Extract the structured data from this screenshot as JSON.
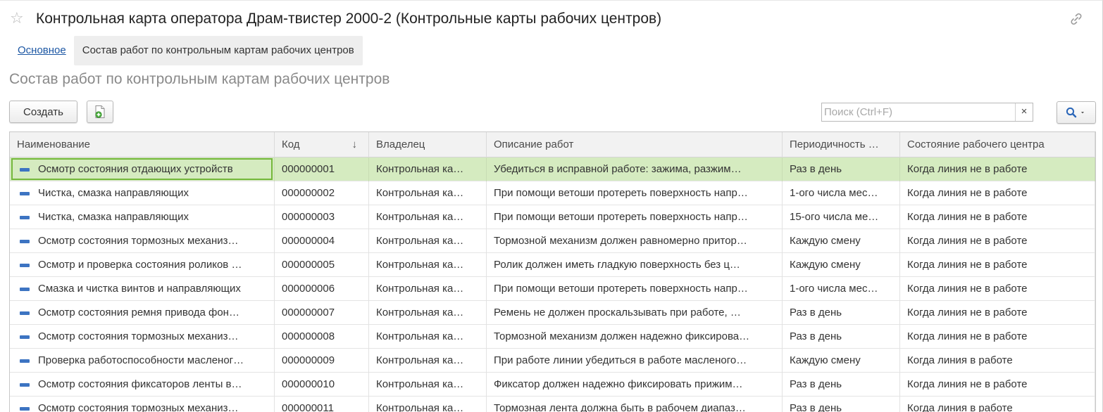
{
  "window": {
    "title": "Контрольная карта оператора Драм-твистер 2000-2 (Контрольные карты рабочих центров)"
  },
  "tabs": {
    "main_link": "Основное",
    "active": "Состав работ по контрольным картам рабочих центров"
  },
  "section": {
    "title": "Состав работ по контрольным картам рабочих центров"
  },
  "toolbar": {
    "create_label": "Создать",
    "search_placeholder": "Поиск (Ctrl+F)",
    "search_clear": "×"
  },
  "table": {
    "columns": [
      "Наименование",
      "Код",
      "Владелец",
      "Описание работ",
      "Периодичность …",
      "Состояние рабочего центра"
    ],
    "sort_indicator": "↓",
    "rows": [
      {
        "name": "Осмотр состояния отдающих устройств",
        "code": "000000001",
        "owner": "Контрольная ка…",
        "description": "Убедиться в исправной работе: зажима, разжим…",
        "period": "Раз в день",
        "state": "Когда линия не в работе"
      },
      {
        "name": "Чистка, смазка направляющих",
        "code": "000000002",
        "owner": "Контрольная ка…",
        "description": "При помощи ветоши протереть поверхность напр…",
        "period": "1-ого числа мес…",
        "state": "Когда линия не в работе"
      },
      {
        "name": "Чистка, смазка направляющих",
        "code": "000000003",
        "owner": "Контрольная ка…",
        "description": "При помощи ветоши протереть поверхность напр…",
        "period": "15-ого числа ме…",
        "state": "Когда линия не в работе"
      },
      {
        "name": "Осмотр состояния тормозных механиз…",
        "code": "000000004",
        "owner": "Контрольная ка…",
        "description": "Тормозной механизм должен равномерно притор…",
        "period": "Каждую смену",
        "state": "Когда линия не в работе"
      },
      {
        "name": "Осмотр и проверка состояния роликов …",
        "code": "000000005",
        "owner": "Контрольная ка…",
        "description": "Ролик должен иметь гладкую поверхность без ц…",
        "period": "Каждую смену",
        "state": "Когда линия не в работе"
      },
      {
        "name": "Смазка и чистка винтов и направляющих",
        "code": "000000006",
        "owner": "Контрольная ка…",
        "description": "При помощи ветоши протереть поверхность напр…",
        "period": "1-ого числа мес…",
        "state": "Когда линия не в работе"
      },
      {
        "name": "Осмотр состояния ремня привода фон…",
        "code": "000000007",
        "owner": "Контрольная ка…",
        "description": "Ремень не должен проскальзывать при работе, …",
        "period": "Раз в день",
        "state": "Когда линия не в работе"
      },
      {
        "name": "Осмотр состояния тормозных механиз…",
        "code": "000000008",
        "owner": "Контрольная ка…",
        "description": "Тормозной механизм должен надежно фиксирова…",
        "period": "Раз в день",
        "state": "Когда линия не в работе"
      },
      {
        "name": "Проверка работоспособности масленог…",
        "code": "000000009",
        "owner": "Контрольная ка…",
        "description": "При работе линии убедиться в работе масленого…",
        "period": "Каждую смену",
        "state": "Когда линия в работе"
      },
      {
        "name": "Осмотр состояния фиксаторов ленты в…",
        "code": "000000010",
        "owner": "Контрольная ка…",
        "description": "Фиксатор должен надежно фиксировать прижим…",
        "period": "Раз в день",
        "state": "Когда линия не в работе"
      },
      {
        "name": "Осмотр состояния тормозных механиз…",
        "code": "000000011",
        "owner": "Контрольная ка…",
        "description": "Тормозная лента должна быть в рабочем диапаз…",
        "period": "Раз в день",
        "state": "Когда линия в работе"
      }
    ]
  },
  "colors": {
    "link": "#1b56a3",
    "selected_row": "#d5ebc0",
    "focus_frame": "#74b83b",
    "row_icon": "#3d74c2"
  }
}
